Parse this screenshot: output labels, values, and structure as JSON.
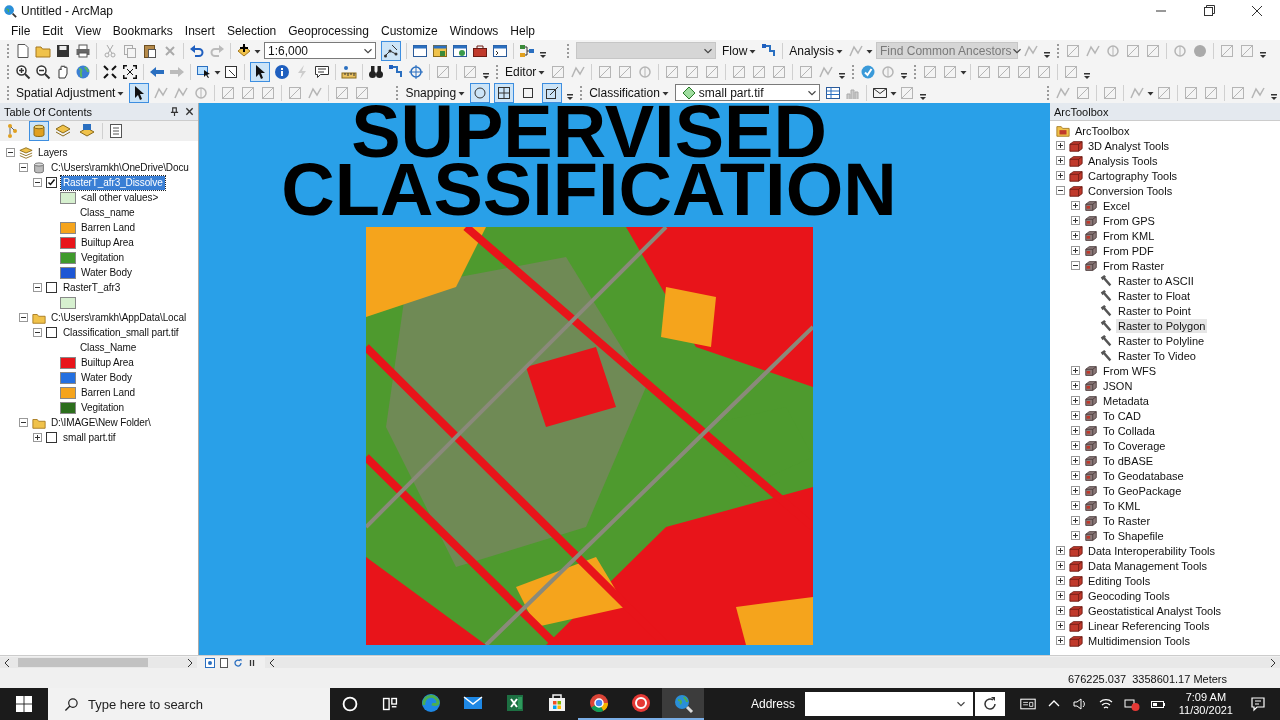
{
  "window": {
    "title": "Untitled - ArcMap"
  },
  "menu": [
    "File",
    "Edit",
    "View",
    "Bookmarks",
    "Insert",
    "Selection",
    "Geoprocessing",
    "Customize",
    "Windows",
    "Help"
  ],
  "toolbars": {
    "scale": "1:6,000",
    "editor_toolbar_button": {
      "selected": true
    },
    "flow": "Flow",
    "analysis": "Analysis",
    "find_field": "Find Common Ancestors",
    "select_elements_tool": {
      "selected": true
    },
    "editor": "Editor",
    "spatial_adjustment": "Spatial Adjustment",
    "adjustment_select_tool": {
      "selected": true
    },
    "snapping": "Snapping",
    "snapping_modes": [
      {
        "selected": true
      },
      {
        "selected": true
      },
      {
        "selected": false
      },
      {
        "selected": true
      }
    ],
    "classification": "Classification",
    "layer_combo": "small part.tif"
  },
  "toc": {
    "title": "Table Of Contents",
    "view_modes": [
      {
        "selected": false
      },
      {
        "selected": true
      },
      {
        "selected": false
      },
      {
        "selected": false
      }
    ],
    "tree": [
      {
        "label": "Layers",
        "kind": "frame",
        "expanded": true,
        "children": [
          {
            "label": "C:\\Users\\ramkh\\OneDrive\\Docu",
            "kind": "database",
            "expanded": true,
            "children": [
              {
                "label": "RasterT_afr3_Dissolve",
                "kind": "layer",
                "expanded": true,
                "checked": true,
                "selected": true,
                "children": [
                  {
                    "label": "<all other values>",
                    "kind": "legend",
                    "color": "#d6f0cf"
                  },
                  {
                    "label": "Class_name",
                    "kind": "heading"
                  },
                  {
                    "label": "Barren Land",
                    "kind": "legend",
                    "color": "#f5a41c"
                  },
                  {
                    "label": "Builtup Area",
                    "kind": "legend",
                    "color": "#e8141a"
                  },
                  {
                    "label": "Vegitation",
                    "kind": "legend",
                    "color": "#3f9a2c"
                  },
                  {
                    "label": "Water Body",
                    "kind": "legend",
                    "color": "#1d56d4"
                  }
                ]
              },
              {
                "label": "RasterT_afr3",
                "kind": "layer",
                "expanded": true,
                "checked": false,
                "selected": false,
                "children": [
                  {
                    "kind": "legend",
                    "color": "#d6f0cf"
                  }
                ]
              }
            ]
          },
          {
            "label": "C:\\Users\\ramkh\\AppData\\Local",
            "kind": "folder",
            "expanded": true,
            "children": [
              {
                "label": "Classification_small part.tif",
                "kind": "layer",
                "expanded": true,
                "checked": false,
                "selected": false,
                "children": [
                  {
                    "label": "Class_Name",
                    "kind": "heading"
                  },
                  {
                    "label": "Builtup Area",
                    "kind": "legend",
                    "color": "#e8141a"
                  },
                  {
                    "label": "Water Body",
                    "kind": "legend",
                    "color": "#2470e0"
                  },
                  {
                    "label": "Barren Land",
                    "kind": "legend",
                    "color": "#f5a41c"
                  },
                  {
                    "label": "Vegitation",
                    "kind": "legend",
                    "color": "#2c6e1c"
                  }
                ]
              }
            ]
          },
          {
            "label": "D:\\IMAGE\\New Folder\\",
            "kind": "folder",
            "expanded": true,
            "children": [
              {
                "label": "small part.tif",
                "kind": "layer",
                "expanded": false,
                "checked": false,
                "selected": false
              }
            ]
          }
        ]
      }
    ]
  },
  "map": {
    "title_lines": [
      "SUPERVISED",
      "CLASSIFICATION"
    ]
  },
  "toolbox": {
    "title": "ArcToolbox",
    "tree": [
      {
        "label": "ArcToolbox",
        "kind": "root",
        "children": [
          {
            "label": "3D Analyst Tools",
            "kind": "toolbox",
            "expanded": false
          },
          {
            "label": "Analysis Tools",
            "kind": "toolbox",
            "expanded": false
          },
          {
            "label": "Cartography Tools",
            "kind": "toolbox",
            "expanded": false
          },
          {
            "label": "Conversion Tools",
            "kind": "toolbox",
            "expanded": true,
            "children": [
              {
                "label": "Excel",
                "kind": "toolset",
                "expanded": false
              },
              {
                "label": "From GPS",
                "kind": "toolset",
                "expanded": false
              },
              {
                "label": "From KML",
                "kind": "toolset",
                "expanded": false
              },
              {
                "label": "From PDF",
                "kind": "toolset",
                "expanded": false
              },
              {
                "label": "From Raster",
                "kind": "toolset",
                "expanded": true,
                "children": [
                  {
                    "label": "Raster to ASCII",
                    "kind": "tool",
                    "selected": false
                  },
                  {
                    "label": "Raster to Float",
                    "kind": "tool",
                    "selected": false
                  },
                  {
                    "label": "Raster to Point",
                    "kind": "tool",
                    "selected": false
                  },
                  {
                    "label": "Raster to Polygon",
                    "kind": "tool",
                    "selected": true
                  },
                  {
                    "label": "Raster to Polyline",
                    "kind": "tool",
                    "selected": false
                  },
                  {
                    "label": "Raster To Video",
                    "kind": "tool",
                    "selected": false
                  }
                ]
              },
              {
                "label": "From WFS",
                "kind": "toolset",
                "expanded": false
              },
              {
                "label": "JSON",
                "kind": "toolset",
                "expanded": false
              },
              {
                "label": "Metadata",
                "kind": "toolset",
                "expanded": false
              },
              {
                "label": "To CAD",
                "kind": "toolset",
                "expanded": false
              },
              {
                "label": "To Collada",
                "kind": "toolset",
                "expanded": false
              },
              {
                "label": "To Coverage",
                "kind": "toolset",
                "expanded": false
              },
              {
                "label": "To dBASE",
                "kind": "toolset",
                "expanded": false
              },
              {
                "label": "To Geodatabase",
                "kind": "toolset",
                "expanded": false
              },
              {
                "label": "To GeoPackage",
                "kind": "toolset",
                "expanded": false
              },
              {
                "label": "To KML",
                "kind": "toolset",
                "expanded": false
              },
              {
                "label": "To Raster",
                "kind": "toolset",
                "expanded": false
              },
              {
                "label": "To Shapefile",
                "kind": "toolset",
                "expanded": false
              }
            ]
          },
          {
            "label": "Data Interoperability Tools",
            "kind": "toolbox",
            "expanded": false
          },
          {
            "label": "Data Management Tools",
            "kind": "toolbox",
            "expanded": false
          },
          {
            "label": "Editing Tools",
            "kind": "toolbox",
            "expanded": false
          },
          {
            "label": "Geocoding Tools",
            "kind": "toolbox",
            "expanded": false
          },
          {
            "label": "Geostatistical Analyst Tools",
            "kind": "toolbox",
            "expanded": false
          },
          {
            "label": "Linear Referencing Tools",
            "kind": "toolbox",
            "expanded": false
          },
          {
            "label": "Multidimension Tools",
            "kind": "toolbox",
            "expanded": false
          }
        ]
      }
    ]
  },
  "status_bar": {
    "coordinates": "676225.037  3358601.17 Meters"
  },
  "taskbar": {
    "search": {
      "placeholder": "Type here to search"
    },
    "apps": [
      {
        "running": false,
        "selected": false
      },
      {
        "running": false,
        "selected": false
      },
      {
        "running": false,
        "selected": false
      },
      {
        "running": false,
        "selected": false
      },
      {
        "running": true,
        "selected": false
      },
      {
        "running": true,
        "selected": false
      },
      {
        "running": true,
        "selected": true
      }
    ],
    "address_label": "Address",
    "time": "7:09 AM",
    "date": "11/30/2021"
  }
}
